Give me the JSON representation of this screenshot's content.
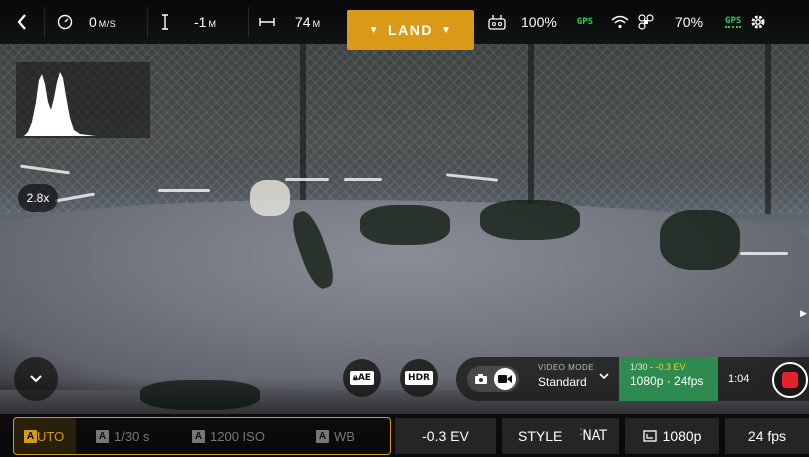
{
  "top_bar": {
    "back_icon": "chevron-left-icon",
    "speed": {
      "value": "0",
      "unit": "M/S",
      "icon": "speedometer-icon"
    },
    "altitude": {
      "value": "-1",
      "unit": "M",
      "icon": "altitude-icon"
    },
    "distance": {
      "value": "74",
      "unit": "M",
      "icon": "distance-icon"
    },
    "land_button": {
      "label": "LAND"
    },
    "controller": {
      "battery": "100%",
      "gps": "GPS",
      "icon": "controller-icon"
    },
    "drone": {
      "battery": "70%",
      "gps": "GPS",
      "wifi_icon": "wifi-icon",
      "drone_icon": "drone-icon"
    },
    "settings_icon": "gear-icon"
  },
  "zoom_badge": "2.8x",
  "controls": {
    "ae_lock": "AE",
    "hdr": "HDR",
    "video_mode": {
      "label": "VIDEO MODE",
      "value": "Standard"
    },
    "exposure": {
      "shutter": "1/30",
      "ev": "-0.3 EV",
      "resolution_fps": "1080p · 24fps"
    },
    "record_time": "1:04"
  },
  "bottom_bar": {
    "auto": {
      "badge": "A",
      "label": "UTO"
    },
    "shutter": {
      "badge": "A",
      "label": "1/30 s"
    },
    "iso": {
      "badge": "A",
      "label": "1200 ISO"
    },
    "wb": {
      "badge": "A",
      "label": "WB"
    },
    "ev": "-0.3 EV",
    "style": {
      "label": "STYLE",
      "value": "NAT"
    },
    "resolution": "1080p",
    "fps": "24 fps"
  },
  "colors": {
    "accent_orange": "#d99a17",
    "gps_green": "#2ecc52",
    "exposure_green": "#2f8a4f",
    "record_red": "#e8202c"
  }
}
